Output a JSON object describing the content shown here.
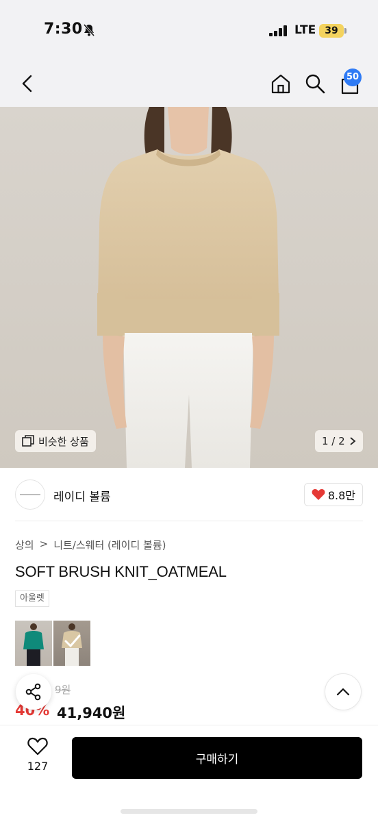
{
  "status_bar": {
    "time": "7:30",
    "network": "LTE",
    "battery": "39"
  },
  "nav": {
    "cart_count": "50",
    "icons": [
      "back-icon",
      "home-icon",
      "search-icon",
      "shopping-bag-icon"
    ]
  },
  "hero": {
    "similar_label": "비슷한 상품",
    "page_indicator": "1 / 2"
  },
  "brand": {
    "name": "레이디 볼륨",
    "likes": "8.8만"
  },
  "breadcrumb": {
    "category": "상의",
    "subcategory": "니트/스웨터 (레이디 볼륨)"
  },
  "product": {
    "title": "SOFT BRUSH KNIT_OATMEAL",
    "tag": "아울렛",
    "original_price": "9원",
    "discount": "40%",
    "price": "41,940원"
  },
  "bottom": {
    "like_count": "127",
    "buy_label": "구매하기"
  },
  "colors": {
    "accent_badge": "#2f7bf5",
    "heart": "#e53935",
    "discount": "#e53935",
    "buy_button": "#000000"
  }
}
